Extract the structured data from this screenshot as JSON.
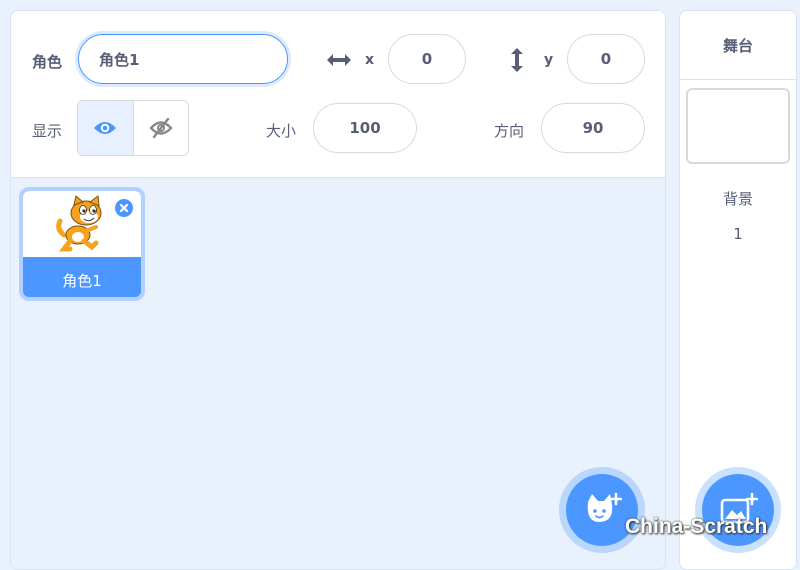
{
  "sprite_info": {
    "sprite_label": "角色",
    "sprite_name": "角色1",
    "x_label": "x",
    "x_value": "0",
    "y_label": "y",
    "y_value": "0",
    "show_label": "显示",
    "size_label": "大小",
    "size_value": "100",
    "direction_label": "方向",
    "direction_value": "90",
    "visible": true
  },
  "sprites": [
    {
      "name": "角色1",
      "selected": true,
      "thumbnail_icon": "scratch-cat-icon"
    }
  ],
  "stage": {
    "header": "舞台",
    "backdrop_label": "背景",
    "backdrop_count": "1"
  },
  "buttons": {
    "choose_sprite_icon": "add-sprite-cat-icon",
    "choose_backdrop_icon": "add-backdrop-icon"
  },
  "watermark": "China-Scratch",
  "colors": {
    "accent": "#4c97ff",
    "panel_bg": "#e9f1fc",
    "text": "#575e75"
  }
}
